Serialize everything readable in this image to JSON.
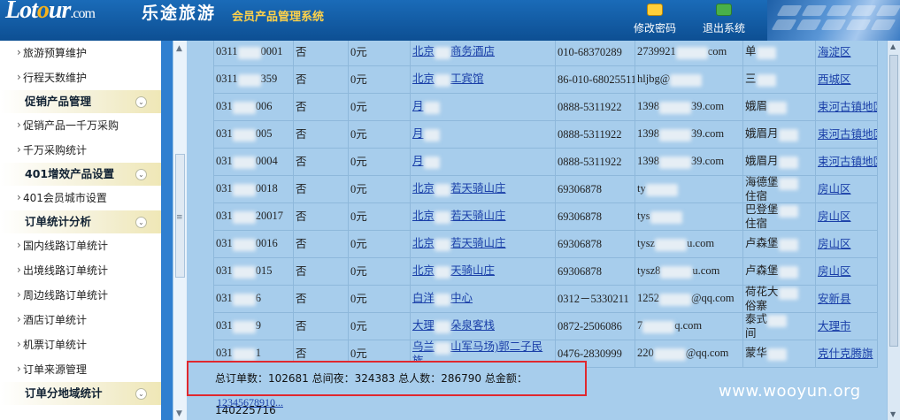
{
  "header": {
    "logo_lot": "Lot",
    "logo_o": "o",
    "logo_ur": "ur",
    "logo_suffix": ".com",
    "logo_cn": "乐途旅游",
    "system_title": "会员产品管理系统",
    "change_password": "修改密码",
    "logout": "退出系统"
  },
  "sidebar": {
    "items": [
      {
        "type": "item",
        "label": "旅游预算维护"
      },
      {
        "type": "item",
        "label": "行程天数维护"
      },
      {
        "type": "group",
        "label": "促销产品管理"
      },
      {
        "type": "item",
        "label": "促销产品一千万采购"
      },
      {
        "type": "item",
        "label": "千万采购统计"
      },
      {
        "type": "group",
        "label": "401增效产品设置"
      },
      {
        "type": "item",
        "label": "401会员城市设置"
      },
      {
        "type": "group",
        "label": "订单统计分析"
      },
      {
        "type": "item",
        "label": "国内线路订单统计"
      },
      {
        "type": "item",
        "label": "出境线路订单统计"
      },
      {
        "type": "item",
        "label": "周边线路订单统计"
      },
      {
        "type": "item",
        "label": "酒店订单统计"
      },
      {
        "type": "item",
        "label": "机票订单统计"
      },
      {
        "type": "item",
        "label": "订单来源管理"
      },
      {
        "type": "group",
        "label": "订单分地域统计"
      }
    ]
  },
  "table": {
    "rows": [
      {
        "id_a": "0311",
        "id_b": "0001",
        "flag": "否",
        "amount": "0元",
        "name_a": "北京",
        "name_b": "商务酒店",
        "phone": "010-68370289",
        "contact_a": "2739921",
        "contact_b": "com",
        "addr_a": "单",
        "addr_b": "",
        "district": "海淀区"
      },
      {
        "id_a": "0311",
        "id_b": "359",
        "flag": "否",
        "amount": "0元",
        "name_a": "北京",
        "name_b": "工宾馆",
        "phone": "86-010-68025511",
        "contact_a": "hljbg@",
        "contact_b": "",
        "addr_a": "三",
        "addr_b": "",
        "district": "西城区"
      },
      {
        "id_a": "031",
        "id_b": "006",
        "flag": "否",
        "amount": "0元",
        "name_a": "月",
        "name_b": "",
        "phone": "0888-5311922",
        "contact_a": "1398",
        "contact_b": "39.com",
        "addr_a": "娥眉",
        "addr_b": "",
        "district": "束河古镇地区"
      },
      {
        "id_a": "031",
        "id_b": "005",
        "flag": "否",
        "amount": "0元",
        "name_a": "月",
        "name_b": "",
        "phone": "0888-5311922",
        "contact_a": "1398",
        "contact_b": "39.com",
        "addr_a": "娥眉月",
        "addr_b": "",
        "district": "束河古镇地区"
      },
      {
        "id_a": "031",
        "id_b": "0004",
        "flag": "否",
        "amount": "0元",
        "name_a": "月",
        "name_b": "",
        "phone": "0888-5311922",
        "contact_a": "1398",
        "contact_b": "39.com",
        "addr_a": "娥眉月",
        "addr_b": "",
        "district": "束河古镇地区"
      },
      {
        "id_a": "031",
        "id_b": "0018",
        "flag": "否",
        "amount": "0元",
        "name_a": "北京",
        "name_b": "若天骑山庄",
        "phone": "69306878",
        "contact_a": "ty",
        "contact_b": "",
        "addr_a": "海德堡",
        "addr_b": "住宿",
        "district": "房山区"
      },
      {
        "id_a": "031",
        "id_b": "20017",
        "flag": "否",
        "amount": "0元",
        "name_a": "北京",
        "name_b": "若天骑山庄",
        "phone": "69306878",
        "contact_a": "tys",
        "contact_b": "",
        "addr_a": "巴登堡",
        "addr_b": "住宿",
        "district": "房山区"
      },
      {
        "id_a": "031",
        "id_b": "0016",
        "flag": "否",
        "amount": "0元",
        "name_a": "北京",
        "name_b": "若天骑山庄",
        "phone": "69306878",
        "contact_a": "tysz",
        "contact_b": "u.com",
        "addr_a": "卢森堡",
        "addr_b": "",
        "district": "房山区"
      },
      {
        "id_a": "031",
        "id_b": "015",
        "flag": "否",
        "amount": "0元",
        "name_a": "北京",
        "name_b": "天骑山庄",
        "phone": "69306878",
        "contact_a": "tysz8",
        "contact_b": "u.com",
        "addr_a": "卢森堡",
        "addr_b": "",
        "district": "房山区"
      },
      {
        "id_a": "031",
        "id_b": "6",
        "flag": "否",
        "amount": "0元",
        "name_a": "白洋",
        "name_b": "中心",
        "phone": "0312－5330211",
        "contact_a": "1252",
        "contact_b": "@qq.com",
        "addr_a": "荷花大",
        "addr_b": "俗寨",
        "district": "安新县"
      },
      {
        "id_a": "031",
        "id_b": "9",
        "flag": "否",
        "amount": "0元",
        "name_a": "大理",
        "name_b": "朵泉客栈",
        "phone": "0872-2506086",
        "contact_a": "7",
        "contact_b": "q.com",
        "addr_a": "泰式",
        "addr_b": "间",
        "district": "大理市"
      },
      {
        "id_a": "031",
        "id_b": "1",
        "flag": "否",
        "amount": "0元",
        "name_a": "乌兰",
        "name_b": "山军马场)郭二子民族",
        "phone": "0476-2830999",
        "contact_a": "220",
        "contact_b": "@qq.com",
        "addr_a": "蒙华",
        "addr_b": "",
        "district": "克什克腾旗"
      }
    ]
  },
  "summary": {
    "text": "总订单数：102681 总间夜：324383 总人数：286790 总金额：140225716"
  },
  "pager": {
    "pages": [
      "1",
      "2",
      "3",
      "4",
      "5",
      "6",
      "7",
      "8",
      "9",
      "10",
      "..."
    ]
  },
  "watermark": "www.wooyun.org",
  "colors": {
    "header_blue": "#0d4f93",
    "link_blue": "#1a3fa8",
    "table_bg": "#a7cdec",
    "highlight_red": "#e0282e"
  }
}
